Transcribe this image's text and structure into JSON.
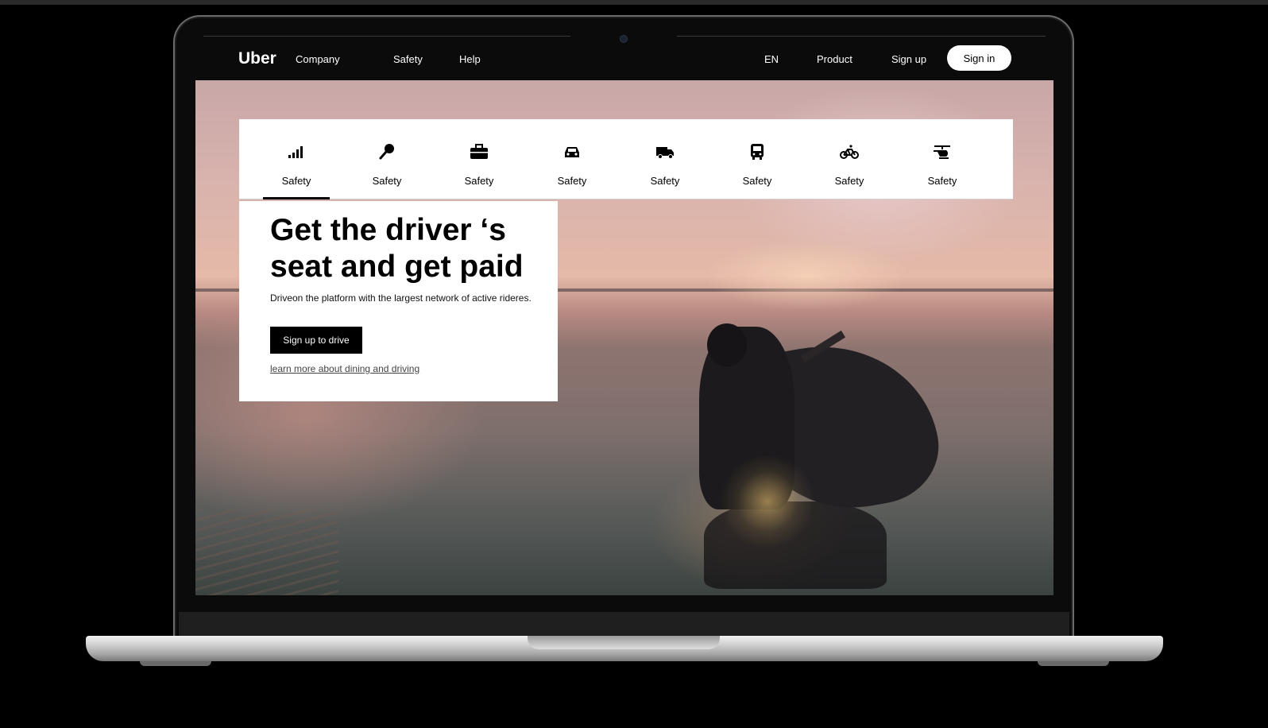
{
  "nav": {
    "logo": "Uber",
    "links_left": [
      "Company",
      "Safety",
      "Help"
    ],
    "links_right": [
      "EN",
      "Product",
      "Sign up"
    ],
    "signin": "Sign in"
  },
  "tabs": [
    {
      "label": "Safety",
      "icon": "signal-bars-icon"
    },
    {
      "label": "Safety",
      "icon": "microphone-icon"
    },
    {
      "label": "Safety",
      "icon": "briefcase-icon"
    },
    {
      "label": "Safety",
      "icon": "car-icon"
    },
    {
      "label": "Safety",
      "icon": "truck-icon"
    },
    {
      "label": "Safety",
      "icon": "bus-icon"
    },
    {
      "label": "Safety",
      "icon": "bicycle-icon"
    },
    {
      "label": "Safety",
      "icon": "helicopter-icon"
    }
  ],
  "active_tab": 0,
  "hero": {
    "title": "Get the driver ‘s seat and get paid",
    "subtitle": "Driveon the platform with the largest network of active rideres.",
    "cta": "Sign up to drive",
    "learn_more": "learn more about dining and driving"
  },
  "colors": {
    "accent": "#000000",
    "card": "#ffffff"
  }
}
